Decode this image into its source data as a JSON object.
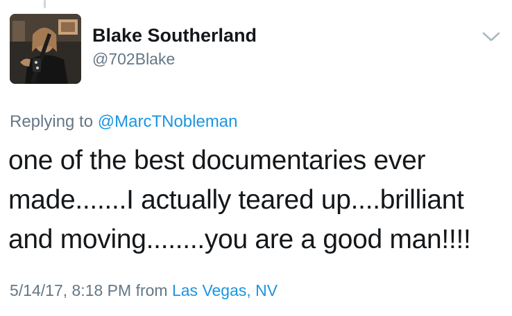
{
  "user": {
    "display_name": "Blake Southerland",
    "handle": "@702Blake"
  },
  "reply": {
    "prefix": "Replying to ",
    "mention": "@MarcTNobleman"
  },
  "tweet": {
    "lines": [
      "one of the best documentaries ever",
      "made.......I actually teared up....brilliant",
      "and moving........you are a good man!!!!"
    ]
  },
  "meta": {
    "timestamp": "5/14/17, 8:18 PM",
    "from_label": " from ",
    "location": "Las Vegas, NV"
  },
  "icons": {
    "menu": "chevron-down-icon"
  },
  "colors": {
    "text_primary": "#14171a",
    "text_secondary": "#657786",
    "link": "#1b95e0",
    "chevron": "#aab8c2"
  }
}
